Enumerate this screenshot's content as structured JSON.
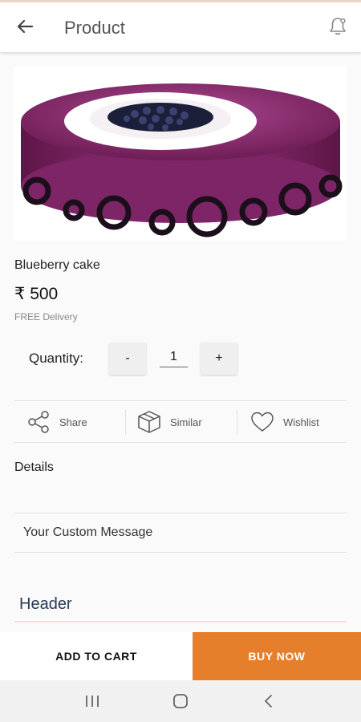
{
  "appbar": {
    "title": "Product",
    "back_icon": "arrow-left-icon",
    "notification_icon": "bell-icon"
  },
  "product": {
    "image_alt": "Blueberry cake",
    "name": "Blueberry cake",
    "price": "₹ 500",
    "delivery": "FREE Delivery"
  },
  "quantity": {
    "label": "Quantity:",
    "minus": "-",
    "value": "1",
    "plus": "+"
  },
  "actions": {
    "share": "Share",
    "similar": "Similar",
    "wishlist": "Wishlist"
  },
  "sections": {
    "details": "Details",
    "custom_message_placeholder": "Your Custom Message",
    "header_placeholder": "Header"
  },
  "buttons": {
    "add_to_cart": "ADD TO CART",
    "buy_now": "BUY NOW"
  },
  "colors": {
    "accent": "#e57f2b",
    "cake": "#8a2a6e"
  },
  "system_nav": {
    "recents_icon": "recents-icon",
    "home_icon": "home-icon",
    "back_icon": "system-back-icon"
  }
}
